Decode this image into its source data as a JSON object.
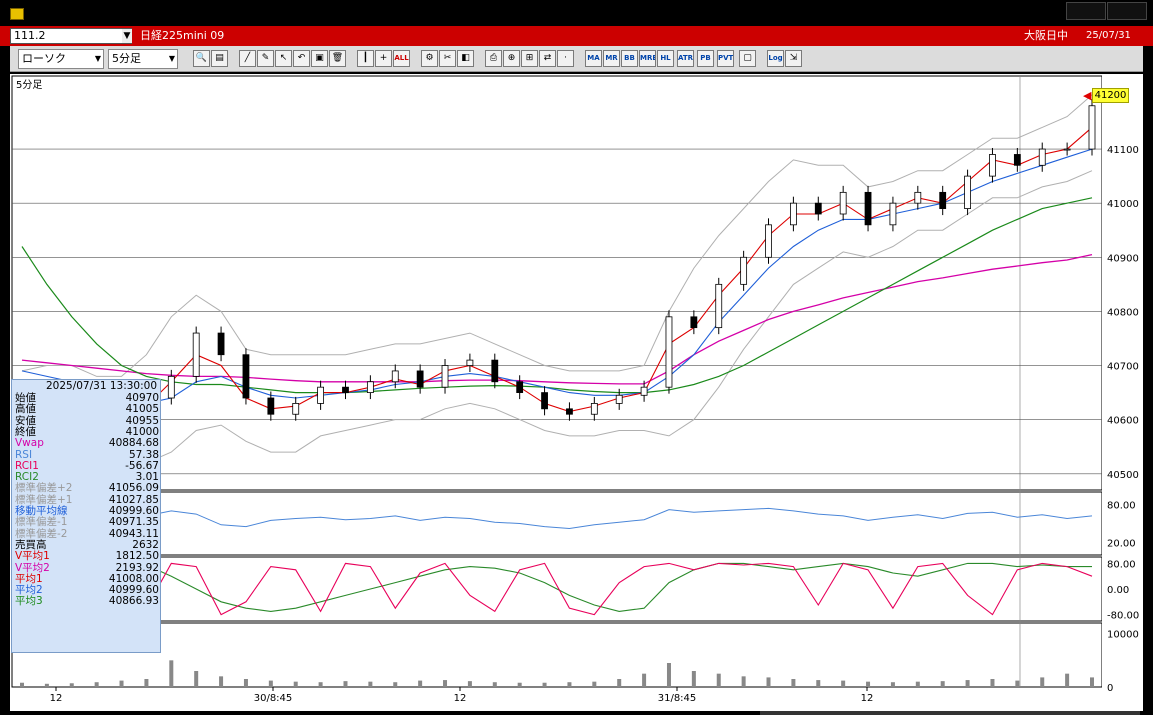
{
  "window": {
    "title_visible": ""
  },
  "header": {
    "symbol_code": "111.2",
    "symbol_name": "日経225mini 09",
    "market_status": "大阪日中",
    "date": "25/07/31"
  },
  "toolbar": {
    "chart_type": "ローソク",
    "timeframe": "5分足",
    "buttons": [
      {
        "name": "zoom-icon",
        "glyph": "🔍"
      },
      {
        "name": "layout-icon",
        "glyph": "▤"
      },
      {
        "name": "draw-line-icon",
        "glyph": "╱"
      },
      {
        "name": "pen-icon",
        "glyph": "✎"
      },
      {
        "name": "cursor-icon",
        "glyph": "↖"
      },
      {
        "name": "undo-icon",
        "glyph": "↶"
      },
      {
        "name": "note-icon",
        "glyph": "▣"
      },
      {
        "name": "trash-icon",
        "glyph": "🗑"
      },
      {
        "name": "candle-icon",
        "glyph": "┃"
      },
      {
        "name": "candle-add-icon",
        "glyph": "+"
      },
      {
        "name": "all-icon",
        "glyph": "ALL"
      },
      {
        "name": "settings-icon",
        "glyph": "⚙"
      },
      {
        "name": "tool-icon",
        "glyph": "✂"
      },
      {
        "name": "color-icon",
        "glyph": "◧"
      },
      {
        "name": "print-icon",
        "glyph": "⎙"
      },
      {
        "name": "search-price-icon",
        "glyph": "⊕"
      },
      {
        "name": "table-icon",
        "glyph": "⊞"
      },
      {
        "name": "compare-icon",
        "glyph": "⇄"
      },
      {
        "name": "disabled-icon",
        "glyph": "·"
      },
      {
        "name": "ma-icon",
        "glyph": "MA"
      },
      {
        "name": "mr-icon",
        "glyph": "MR"
      },
      {
        "name": "bb-icon",
        "glyph": "BB"
      },
      {
        "name": "mre-icon",
        "glyph": "MRE"
      },
      {
        "name": "hl-icon",
        "glyph": "HL"
      },
      {
        "name": "atr-icon",
        "glyph": "ATR"
      },
      {
        "name": "parabolic-icon",
        "glyph": "PB"
      },
      {
        "name": "pvt-icon",
        "glyph": "PVT"
      },
      {
        "name": "window-icon",
        "glyph": "▢"
      },
      {
        "name": "log-icon",
        "glyph": "Log"
      },
      {
        "name": "export-icon",
        "glyph": "⇲"
      }
    ]
  },
  "colors": {
    "candle_up": "#ffffff",
    "candle_down": "#000000",
    "ma_short": "#dd0000",
    "ma_mid": "#1f5fd8",
    "ma_long": "#1b8a1b",
    "vwap": "#d400a8",
    "band": "#b0b0b0",
    "rsi": "#4a86d8",
    "rci1": "#e8005a",
    "rci2": "#2a8a2a",
    "badge": "#ffff33"
  },
  "chart_data": [
    {
      "type": "line",
      "panel": "price",
      "label": "5分足",
      "y_ticks": [
        "41100",
        "41000",
        "40900",
        "40800",
        "40700",
        "40600",
        "40500"
      ],
      "ylim": [
        40470,
        41235
      ],
      "x_tick_labels": [
        "12",
        "30/8:45",
        "12",
        "31/8:45",
        "12"
      ],
      "current_price": "41200",
      "close_values": [
        40590,
        40620,
        40610,
        40580,
        40600,
        40640,
        40680,
        40760,
        40720,
        40640,
        40610,
        40630,
        40660,
        40650,
        40670,
        40690,
        40660,
        40700,
        40710,
        40670,
        40650,
        40620,
        40610,
        40630,
        40645,
        40660,
        40790,
        40770,
        40850,
        40900,
        40960,
        41000,
        40980,
        41020,
        40960,
        41000,
        41020,
        40990,
        41050,
        41090,
        41070,
        41100,
        41100,
        41180
      ],
      "ma_short": [
        40600,
        40605,
        40610,
        40595,
        40600,
        40625,
        40670,
        40720,
        40700,
        40640,
        40620,
        40625,
        40650,
        40650,
        40660,
        40675,
        40665,
        40690,
        40700,
        40680,
        40660,
        40630,
        40615,
        40625,
        40640,
        40650,
        40740,
        40770,
        40830,
        40880,
        40940,
        40980,
        40980,
        41000,
        40970,
        40990,
        41010,
        41000,
        41040,
        41080,
        41070,
        41090,
        41100,
        41140
      ],
      "ma_mid": [
        40690,
        40680,
        40670,
        40650,
        40640,
        40630,
        40640,
        40670,
        40680,
        40660,
        40645,
        40640,
        40645,
        40650,
        40655,
        40665,
        40670,
        40680,
        40685,
        40680,
        40670,
        40660,
        40650,
        40645,
        40645,
        40650,
        40680,
        40720,
        40780,
        40830,
        40880,
        40920,
        40950,
        40970,
        40970,
        40980,
        40990,
        41000,
        41020,
        41040,
        41055,
        41070,
        41085,
        41100
      ],
      "ma_long": [
        40920,
        40850,
        40790,
        40740,
        40700,
        40680,
        40670,
        40665,
        40665,
        40660,
        40655,
        40650,
        40650,
        40650,
        40652,
        40655,
        40658,
        40660,
        40662,
        40663,
        40662,
        40660,
        40655,
        40652,
        40650,
        40650,
        40655,
        40665,
        40680,
        40700,
        40725,
        40750,
        40775,
        40800,
        40825,
        40850,
        40875,
        40900,
        40925,
        40950,
        40970,
        40990,
        41000,
        41010
      ],
      "vwap": [
        40710,
        40705,
        40700,
        40695,
        40690,
        40685,
        40682,
        40680,
        40680,
        40678,
        40675,
        40672,
        40670,
        40670,
        40670,
        40670,
        40670,
        40672,
        40673,
        40673,
        40672,
        40670,
        40668,
        40667,
        40666,
        40666,
        40690,
        40720,
        40745,
        40765,
        40785,
        40800,
        40812,
        40825,
        40835,
        40845,
        40855,
        40862,
        40870,
        40878,
        40884,
        40890,
        40895,
        40905
      ],
      "band_upper2": [
        40690,
        40700,
        40700,
        40680,
        40680,
        40720,
        40790,
        40830,
        40800,
        40730,
        40720,
        40720,
        40720,
        40720,
        40730,
        40740,
        40740,
        40750,
        40760,
        40740,
        40720,
        40700,
        40690,
        40690,
        40690,
        40700,
        40800,
        40880,
        40940,
        40990,
        41040,
        41080,
        41070,
        41070,
        41030,
        41040,
        41060,
        41060,
        41090,
        41120,
        41120,
        41140,
        41160,
        41200
      ],
      "band_lower2": [
        40530,
        40520,
        40510,
        40500,
        40510,
        40520,
        40540,
        40580,
        40590,
        40560,
        40540,
        40540,
        40570,
        40580,
        40590,
        40600,
        40600,
        40620,
        40630,
        40620,
        40600,
        40580,
        40570,
        40570,
        40580,
        40580,
        40570,
        40600,
        40660,
        40730,
        40790,
        40850,
        40880,
        40910,
        40900,
        40920,
        40950,
        40950,
        40980,
        41010,
        41010,
        41030,
        41040,
        41060
      ]
    },
    {
      "type": "line",
      "panel": "rsi",
      "y_ticks": [
        "80.00",
        "20.00"
      ],
      "ylim": [
        0,
        100
      ],
      "values": [
        55,
        52,
        60,
        58,
        50,
        62,
        70,
        65,
        48,
        45,
        55,
        58,
        60,
        56,
        58,
        62,
        55,
        60,
        58,
        52,
        50,
        45,
        42,
        48,
        52,
        56,
        72,
        68,
        70,
        72,
        74,
        70,
        65,
        62,
        55,
        60,
        64,
        58,
        66,
        68,
        60,
        64,
        58,
        62
      ]
    },
    {
      "type": "line",
      "panel": "rci",
      "y_ticks": [
        "80.00",
        "0.00",
        "-80.00"
      ],
      "ylim": [
        -100,
        100
      ],
      "rci1": [
        -70,
        -20,
        60,
        80,
        30,
        -60,
        80,
        70,
        -80,
        -40,
        70,
        60,
        -70,
        80,
        70,
        -60,
        50,
        80,
        -20,
        -70,
        60,
        80,
        -60,
        -80,
        20,
        70,
        80,
        60,
        80,
        75,
        80,
        70,
        -50,
        80,
        60,
        -60,
        70,
        80,
        -20,
        -80,
        60,
        80,
        70,
        40
      ],
      "rci2": [
        -60,
        -40,
        20,
        60,
        80,
        75,
        40,
        0,
        -40,
        -60,
        -70,
        -60,
        -40,
        -20,
        0,
        20,
        40,
        60,
        70,
        65,
        50,
        20,
        -20,
        -50,
        -70,
        -60,
        20,
        60,
        80,
        80,
        70,
        60,
        70,
        80,
        70,
        50,
        40,
        60,
        80,
        80,
        70,
        75,
        70,
        70
      ]
    },
    {
      "type": "bar",
      "panel": "volume",
      "y_ticks": [
        "10000",
        "0"
      ],
      "ylim": [
        0,
        12000
      ],
      "values": [
        800,
        600,
        700,
        900,
        1200,
        1500,
        5000,
        3000,
        2000,
        1500,
        1200,
        1000,
        900,
        1100,
        1000,
        900,
        1200,
        1300,
        1100,
        900,
        800,
        800,
        900,
        1000,
        1500,
        2500,
        4500,
        3000,
        2500,
        2000,
        1800,
        1500,
        1300,
        1200,
        1000,
        900,
        1000,
        1100,
        1300,
        1500,
        1200,
        1800,
        2500,
        1800
      ]
    }
  ],
  "databox": {
    "datetime": "2025/07/31 13:30:00",
    "rows": [
      {
        "key": "始値",
        "value": "40970",
        "color": "#000000"
      },
      {
        "key": "高値",
        "value": "41005",
        "color": "#000000"
      },
      {
        "key": "安値",
        "value": "40955",
        "color": "#000000"
      },
      {
        "key": "終値",
        "value": "41000",
        "color": "#000000"
      },
      {
        "key": "Vwap",
        "value": "40884.68",
        "color": "#d400a8"
      },
      {
        "key": "RSI",
        "value": "57.38",
        "color": "#4a86d8"
      },
      {
        "key": "RCI1",
        "value": "-56.67",
        "color": "#e8005a"
      },
      {
        "key": "RCI2",
        "value": "3.01",
        "color": "#2a8a2a"
      },
      {
        "key": "標準偏差+2",
        "value": "41056.09",
        "color": "#999999"
      },
      {
        "key": "標準偏差+1",
        "value": "41027.85",
        "color": "#999999"
      },
      {
        "key": "移動平均線",
        "value": "40999.60",
        "color": "#1f5fd8"
      },
      {
        "key": "標準偏差-1",
        "value": "40971.35",
        "color": "#999999"
      },
      {
        "key": "標準偏差-2",
        "value": "40943.11",
        "color": "#999999"
      },
      {
        "key": "売買高",
        "value": "2632",
        "color": "#000000"
      },
      {
        "key": "V平均1",
        "value": "1812.50",
        "color": "#dd0000"
      },
      {
        "key": "V平均2",
        "value": "2193.92",
        "color": "#d400a8"
      },
      {
        "key": "平均1",
        "value": "41008.00",
        "color": "#dd0000"
      },
      {
        "key": "平均2",
        "value": "40999.60",
        "color": "#1f5fd8"
      },
      {
        "key": "平均3",
        "value": "40866.93",
        "color": "#1b8a1b"
      }
    ]
  }
}
